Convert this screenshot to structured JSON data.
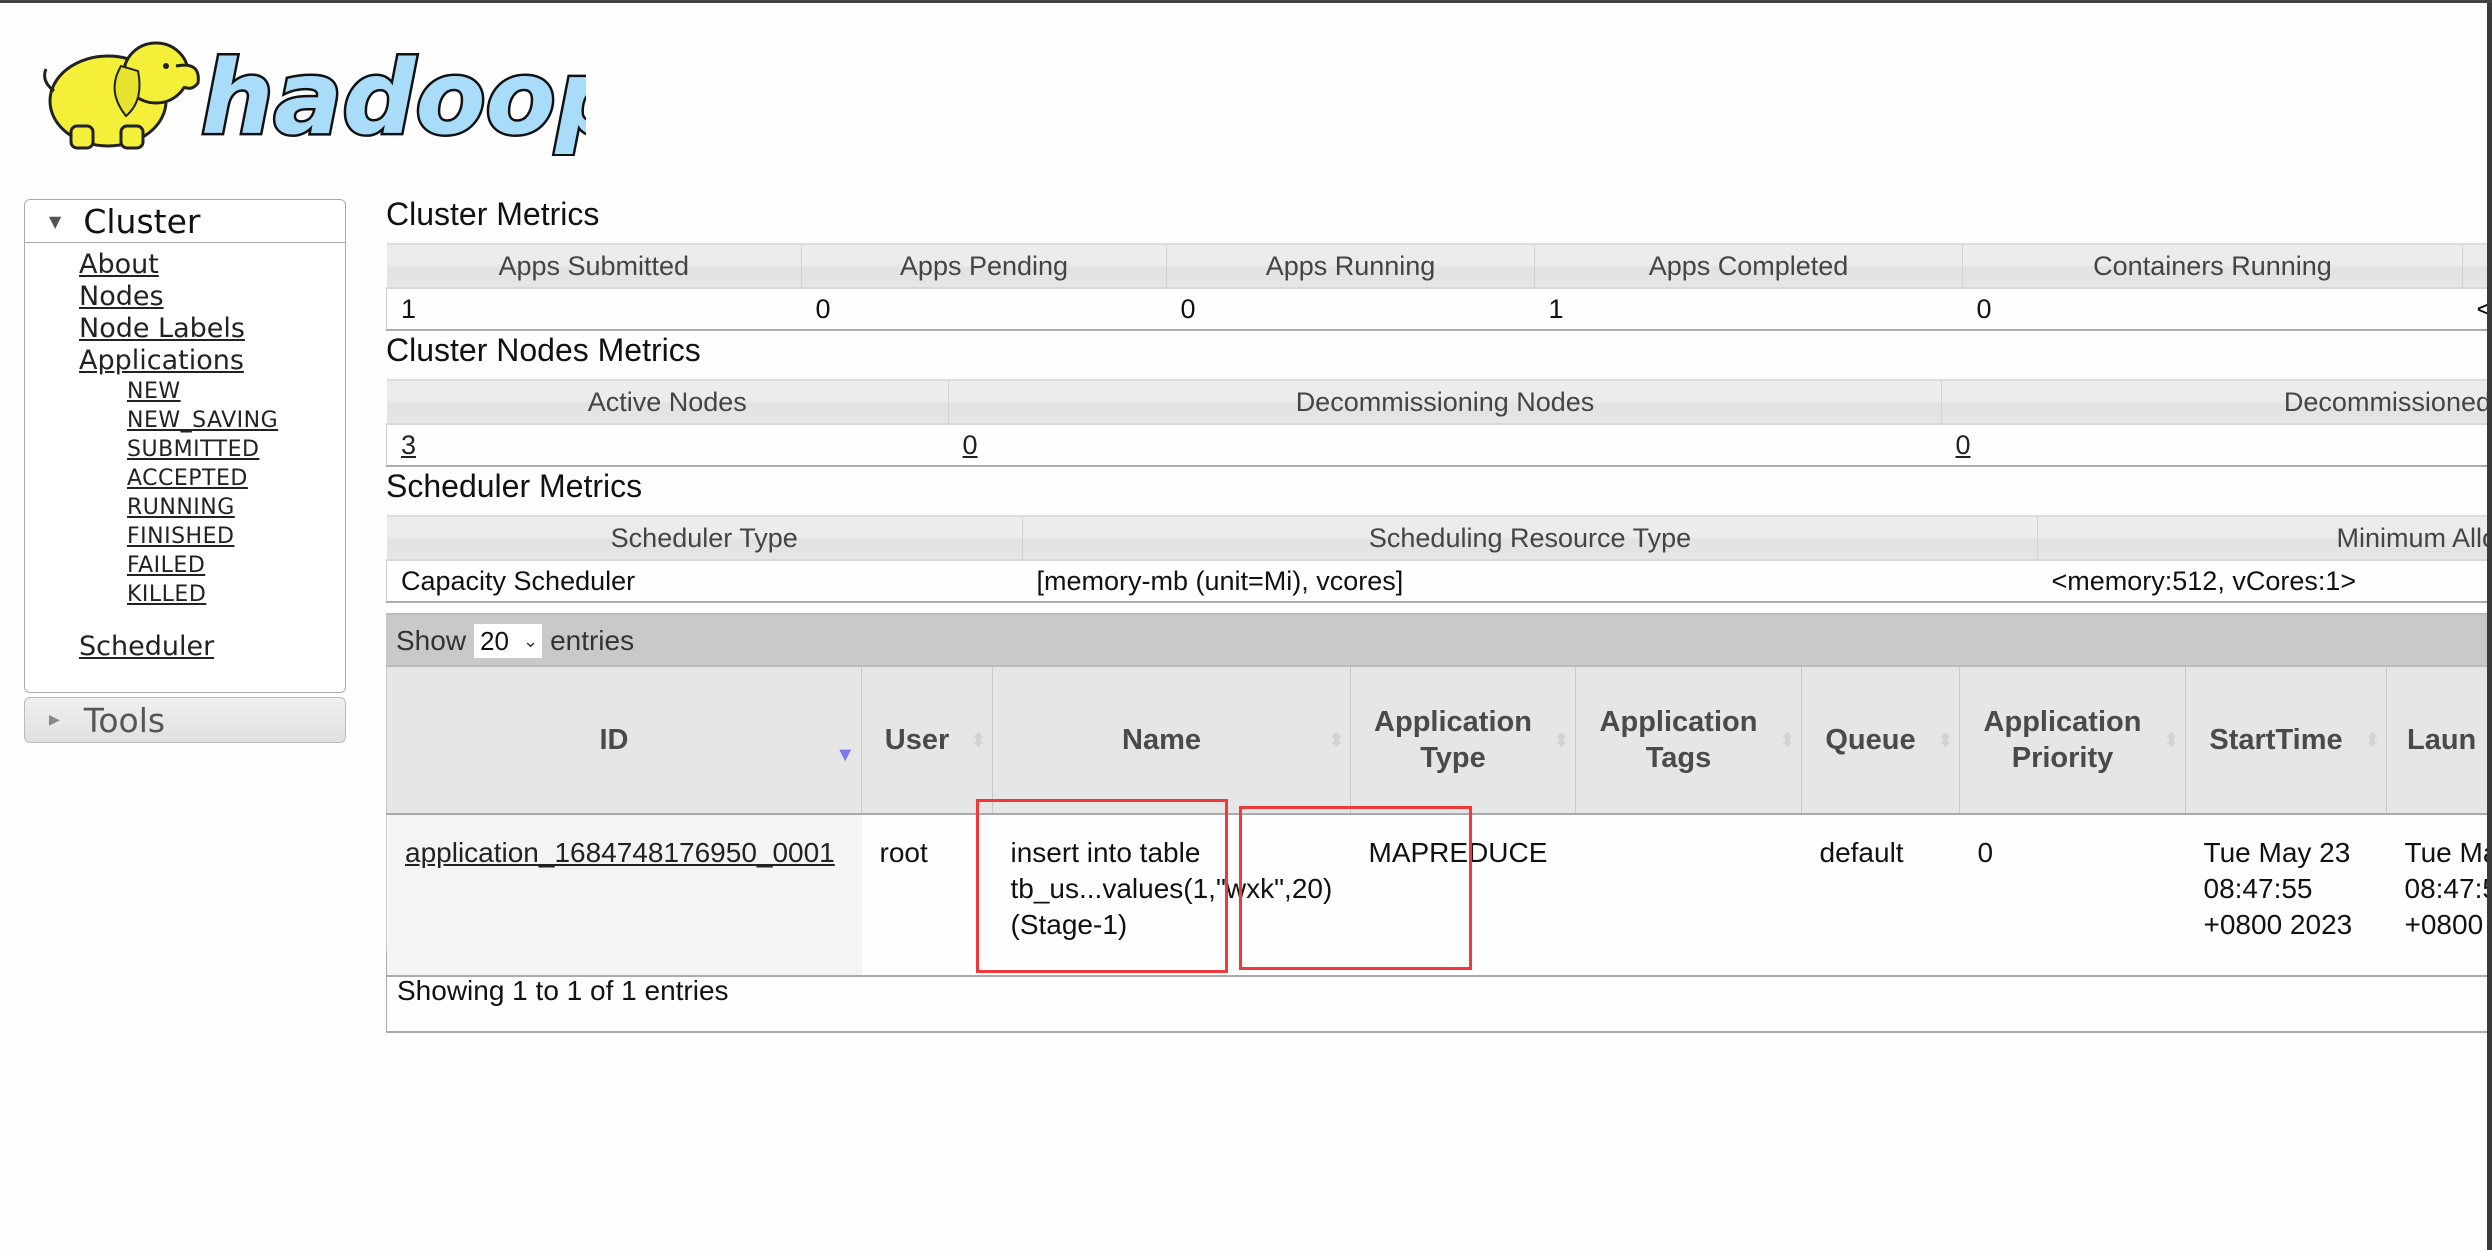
{
  "logo": {
    "text": "hadoop",
    "alt": "hadoop elephant logo"
  },
  "sidebar": {
    "cluster": {
      "title": "Cluster",
      "items": [
        {
          "label": "About"
        },
        {
          "label": "Nodes"
        },
        {
          "label": "Node Labels"
        },
        {
          "label": "Applications"
        }
      ],
      "app_states": [
        "NEW",
        "NEW_SAVING",
        "SUBMITTED",
        "ACCEPTED",
        "RUNNING",
        "FINISHED",
        "FAILED",
        "KILLED"
      ],
      "scheduler": "Scheduler"
    },
    "tools": {
      "title": "Tools"
    }
  },
  "cluster_metrics": {
    "title": "Cluster Metrics",
    "headers": [
      "Apps Submitted",
      "Apps Pending",
      "Apps Running",
      "Apps Completed",
      "Containers Running",
      ""
    ],
    "values": [
      "1",
      "0",
      "0",
      "1",
      "0",
      "<"
    ]
  },
  "cluster_nodes_metrics": {
    "title": "Cluster Nodes Metrics",
    "headers": [
      "Active Nodes",
      "Decommissioning Nodes",
      "Decommissioned"
    ],
    "values": [
      "3",
      "0",
      "0"
    ]
  },
  "scheduler_metrics": {
    "title": "Scheduler Metrics",
    "headers": [
      "Scheduler Type",
      "Scheduling Resource Type",
      "Minimum Allo"
    ],
    "values": [
      "Capacity Scheduler",
      "[memory-mb (unit=Mi), vcores]",
      "<memory:512, vCores:1>"
    ]
  },
  "apps_table": {
    "show_label": "Show",
    "page_size": "20",
    "entries_label": "entries",
    "columns": [
      "ID",
      "User",
      "Name",
      "Application Type",
      "Application Tags",
      "Queue",
      "Application Priority",
      "StartTime",
      "Laun"
    ],
    "sorted_column": "ID",
    "sort_direction": "descending",
    "rows": [
      {
        "id": "application_1684748176950_0001",
        "user": "root",
        "name": "insert into table tb_us...values(1,\"wxk\",20)(Stage-1)",
        "name_lines": [
          "insert into table",
          "tb_us...values(1,\"wxk\",20)",
          "(Stage-1)"
        ],
        "type": "MAPREDUCE",
        "tags": "",
        "queue": "default",
        "priority": "0",
        "start_lines": [
          "Tue May 23",
          "08:47:55",
          "+0800 2023"
        ],
        "launch_lines": [
          "Tue Ma",
          "08:47:5",
          "+0800"
        ]
      }
    ],
    "footer": "Showing 1 to 1 of 1 entries"
  },
  "annotations": {
    "highlight_color": "#f03a3a",
    "highlighted": [
      "Name",
      "Application Type"
    ]
  }
}
